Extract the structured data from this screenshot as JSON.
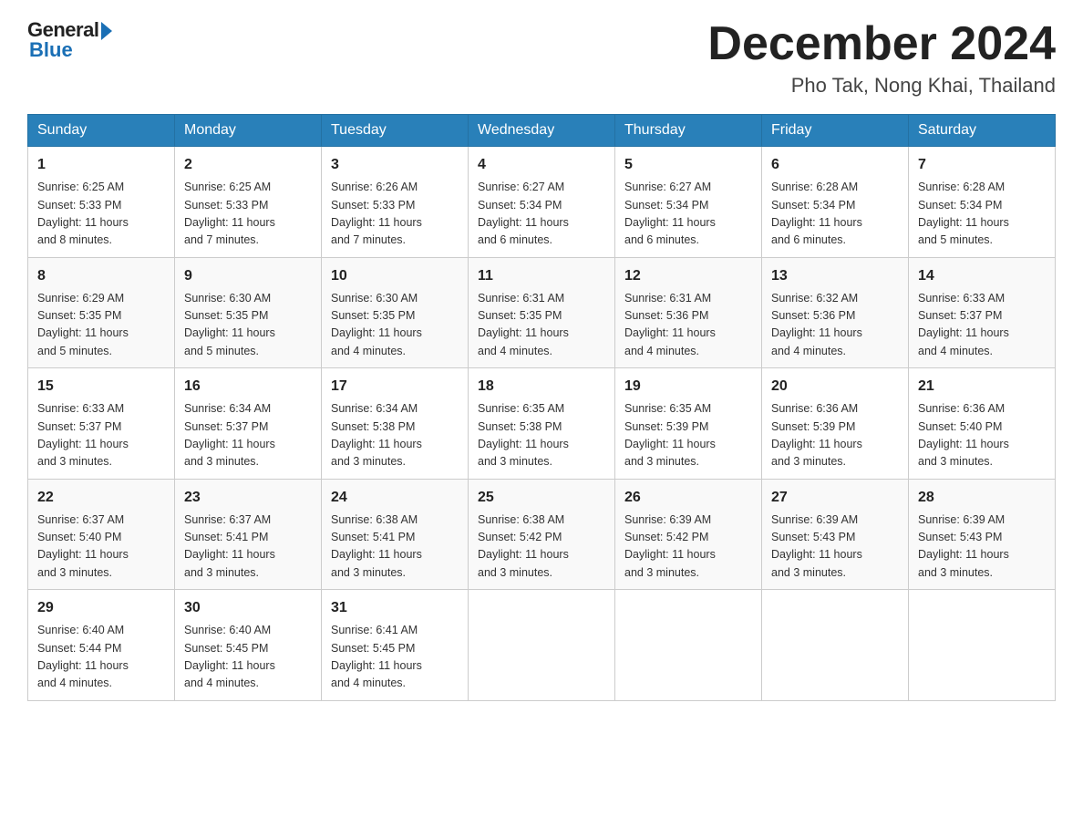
{
  "header": {
    "logo": {
      "general": "General",
      "blue": "Blue"
    },
    "title": "December 2024",
    "location": "Pho Tak, Nong Khai, Thailand"
  },
  "days_of_week": [
    "Sunday",
    "Monday",
    "Tuesday",
    "Wednesday",
    "Thursday",
    "Friday",
    "Saturday"
  ],
  "weeks": [
    [
      {
        "day": "1",
        "sunrise": "6:25 AM",
        "sunset": "5:33 PM",
        "daylight": "11 hours and 8 minutes."
      },
      {
        "day": "2",
        "sunrise": "6:25 AM",
        "sunset": "5:33 PM",
        "daylight": "11 hours and 7 minutes."
      },
      {
        "day": "3",
        "sunrise": "6:26 AM",
        "sunset": "5:33 PM",
        "daylight": "11 hours and 7 minutes."
      },
      {
        "day": "4",
        "sunrise": "6:27 AM",
        "sunset": "5:34 PM",
        "daylight": "11 hours and 6 minutes."
      },
      {
        "day": "5",
        "sunrise": "6:27 AM",
        "sunset": "5:34 PM",
        "daylight": "11 hours and 6 minutes."
      },
      {
        "day": "6",
        "sunrise": "6:28 AM",
        "sunset": "5:34 PM",
        "daylight": "11 hours and 6 minutes."
      },
      {
        "day": "7",
        "sunrise": "6:28 AM",
        "sunset": "5:34 PM",
        "daylight": "11 hours and 5 minutes."
      }
    ],
    [
      {
        "day": "8",
        "sunrise": "6:29 AM",
        "sunset": "5:35 PM",
        "daylight": "11 hours and 5 minutes."
      },
      {
        "day": "9",
        "sunrise": "6:30 AM",
        "sunset": "5:35 PM",
        "daylight": "11 hours and 5 minutes."
      },
      {
        "day": "10",
        "sunrise": "6:30 AM",
        "sunset": "5:35 PM",
        "daylight": "11 hours and 4 minutes."
      },
      {
        "day": "11",
        "sunrise": "6:31 AM",
        "sunset": "5:35 PM",
        "daylight": "11 hours and 4 minutes."
      },
      {
        "day": "12",
        "sunrise": "6:31 AM",
        "sunset": "5:36 PM",
        "daylight": "11 hours and 4 minutes."
      },
      {
        "day": "13",
        "sunrise": "6:32 AM",
        "sunset": "5:36 PM",
        "daylight": "11 hours and 4 minutes."
      },
      {
        "day": "14",
        "sunrise": "6:33 AM",
        "sunset": "5:37 PM",
        "daylight": "11 hours and 4 minutes."
      }
    ],
    [
      {
        "day": "15",
        "sunrise": "6:33 AM",
        "sunset": "5:37 PM",
        "daylight": "11 hours and 3 minutes."
      },
      {
        "day": "16",
        "sunrise": "6:34 AM",
        "sunset": "5:37 PM",
        "daylight": "11 hours and 3 minutes."
      },
      {
        "day": "17",
        "sunrise": "6:34 AM",
        "sunset": "5:38 PM",
        "daylight": "11 hours and 3 minutes."
      },
      {
        "day": "18",
        "sunrise": "6:35 AM",
        "sunset": "5:38 PM",
        "daylight": "11 hours and 3 minutes."
      },
      {
        "day": "19",
        "sunrise": "6:35 AM",
        "sunset": "5:39 PM",
        "daylight": "11 hours and 3 minutes."
      },
      {
        "day": "20",
        "sunrise": "6:36 AM",
        "sunset": "5:39 PM",
        "daylight": "11 hours and 3 minutes."
      },
      {
        "day": "21",
        "sunrise": "6:36 AM",
        "sunset": "5:40 PM",
        "daylight": "11 hours and 3 minutes."
      }
    ],
    [
      {
        "day": "22",
        "sunrise": "6:37 AM",
        "sunset": "5:40 PM",
        "daylight": "11 hours and 3 minutes."
      },
      {
        "day": "23",
        "sunrise": "6:37 AM",
        "sunset": "5:41 PM",
        "daylight": "11 hours and 3 minutes."
      },
      {
        "day": "24",
        "sunrise": "6:38 AM",
        "sunset": "5:41 PM",
        "daylight": "11 hours and 3 minutes."
      },
      {
        "day": "25",
        "sunrise": "6:38 AM",
        "sunset": "5:42 PM",
        "daylight": "11 hours and 3 minutes."
      },
      {
        "day": "26",
        "sunrise": "6:39 AM",
        "sunset": "5:42 PM",
        "daylight": "11 hours and 3 minutes."
      },
      {
        "day": "27",
        "sunrise": "6:39 AM",
        "sunset": "5:43 PM",
        "daylight": "11 hours and 3 minutes."
      },
      {
        "day": "28",
        "sunrise": "6:39 AM",
        "sunset": "5:43 PM",
        "daylight": "11 hours and 3 minutes."
      }
    ],
    [
      {
        "day": "29",
        "sunrise": "6:40 AM",
        "sunset": "5:44 PM",
        "daylight": "11 hours and 4 minutes."
      },
      {
        "day": "30",
        "sunrise": "6:40 AM",
        "sunset": "5:45 PM",
        "daylight": "11 hours and 4 minutes."
      },
      {
        "day": "31",
        "sunrise": "6:41 AM",
        "sunset": "5:45 PM",
        "daylight": "11 hours and 4 minutes."
      },
      null,
      null,
      null,
      null
    ]
  ],
  "labels": {
    "sunrise": "Sunrise:",
    "sunset": "Sunset:",
    "daylight": "Daylight:"
  }
}
